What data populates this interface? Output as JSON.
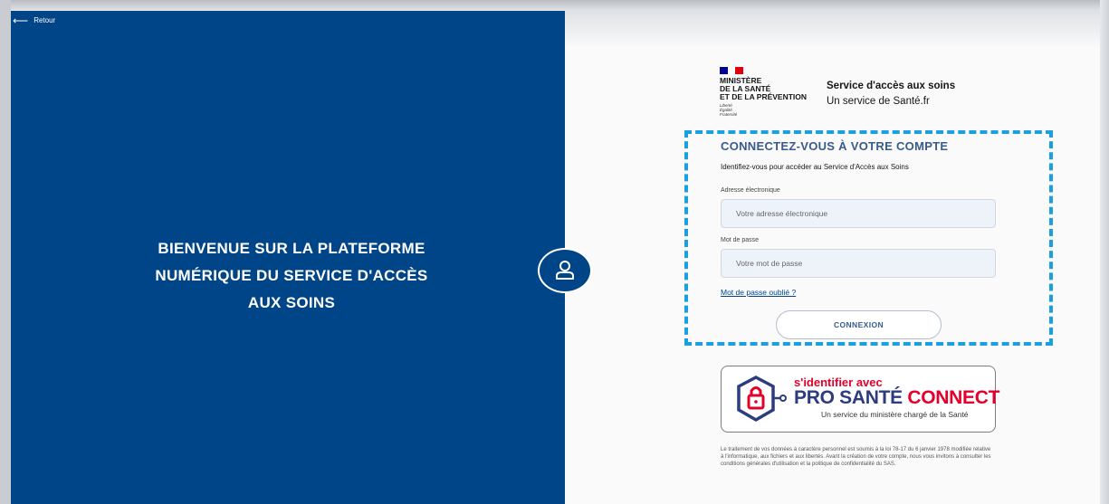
{
  "back_link": {
    "label": "Retour"
  },
  "welcome": {
    "line1": "BIENVENUE SUR LA PLATEFORME",
    "line2": "NUMÉRIQUE DU SERVICE D'ACCÈS",
    "line3": "AUX SOINS"
  },
  "ministry": {
    "name": "MINISTÈRE\nDE LA SANTÉ\nET DE LA PRÉVENTION",
    "motto": "Liberté\nÉgalité\nFraternité"
  },
  "service": {
    "title": "Service d'accès aux soins",
    "subtitle": "Un service de Santé.fr"
  },
  "login": {
    "title": "CONNECTEZ-VOUS À VOTRE COMPTE",
    "subtitle": "Identifiez-vous pour accéder au Service d'Accès aux Soins",
    "email_label": "Adresse électronique",
    "email_placeholder": "Votre adresse électronique",
    "password_label": "Mot de passe",
    "password_placeholder": "Votre mot de passe",
    "forgot_label": "Mot de passe oublié ?",
    "submit_label": "CONNEXION"
  },
  "pro_sante_connect": {
    "line1": "s'identifier avec",
    "pro": "PRO",
    "sante": "SANTÉ",
    "connect": "CONNECT",
    "line3": "Un service du ministère chargé de la Santé"
  },
  "legal_text": "Le traitement de vos données à caractère personnel est soumis à la loi 78-17 du 6 janvier 1978 modifiée relative à l'informatique, aux fichiers et aux libertés. Avant la création de votre compte, nous vous invitons à consulter les conditions générales d'utilisation et la politique de confidentialité du SAS.",
  "colors": {
    "primary_blue": "#004587",
    "title_blue": "#395a8c",
    "dash_blue": "#1aa0de",
    "marianne_red": "#e1000f",
    "psc_red": "#e4002b",
    "psc_navy": "#2c3c7d"
  },
  "icons": [
    "back-arrow-icon",
    "user-icon",
    "lock-hexagon-icon",
    "marianne-flag-icon"
  ]
}
